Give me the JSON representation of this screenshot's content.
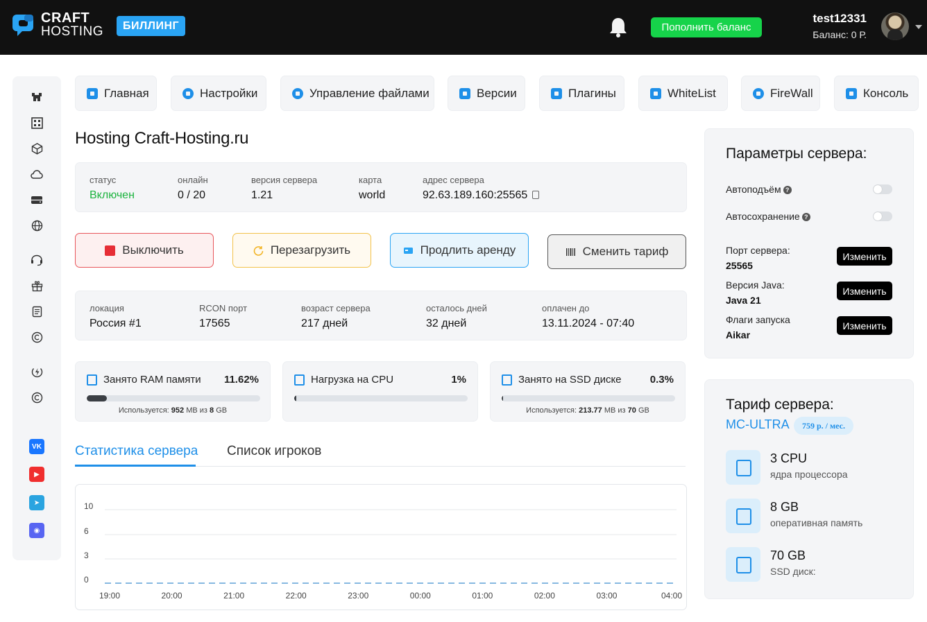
{
  "header": {
    "logo_line1": "CRAFT",
    "logo_line2": "HOSTING",
    "billing_badge": "БИЛЛИНГ",
    "topup_button": "Пополнить баланс",
    "username": "test12331",
    "balance": "Баланс: 0 Р."
  },
  "nav": {
    "tabs": [
      {
        "label": "Главная",
        "icon": "home-icon"
      },
      {
        "label": "Настройки",
        "icon": "gear-icon"
      },
      {
        "label": "Управление файлами",
        "icon": "cloud-icon"
      },
      {
        "label": "Версии",
        "icon": "versions-icon"
      },
      {
        "label": "Плагины",
        "icon": "plugins-icon"
      },
      {
        "label": "WhiteList",
        "icon": "list-icon"
      },
      {
        "label": "FireWall",
        "icon": "shield-icon"
      },
      {
        "label": "Консоль",
        "icon": "console-icon"
      }
    ]
  },
  "server": {
    "title": "Hosting Craft-Hosting.ru",
    "status_label": "статус",
    "status_value": "Включен",
    "online_label": "онлайн",
    "online_value": "0 / 20",
    "version_label": "версия сервера",
    "version_value": "1.21",
    "map_label": "карта",
    "map_value": "world",
    "address_label": "адрес сервера",
    "address_value": "92.63.189.160:25565"
  },
  "actions": {
    "stop": "Выключить",
    "restart": "Перезагрузить",
    "extend": "Продлить аренду",
    "change_tariff": "Сменить тариф"
  },
  "details": {
    "location_label": "локация",
    "location_value": "Россия #1",
    "rcon_label": "RCON порт",
    "rcon_value": "17565",
    "age_label": "возраст сервера",
    "age_value": "217 дней",
    "days_left_label": "осталось дней",
    "days_left_value": "32 дней",
    "paid_until_label": "оплачен до",
    "paid_until_value": "13.11.2024 - 07:40"
  },
  "resources": {
    "ram": {
      "title": "Занято RAM памяти",
      "percent": "11.62%",
      "fill": 0.1162,
      "note_prefix": "Используется:",
      "used": "952",
      "used_unit": "MB из",
      "total": "8",
      "total_unit": "GB"
    },
    "cpu": {
      "title": "Нагрузка на CPU",
      "percent": "1%",
      "fill": 0.01
    },
    "ssd": {
      "title": "Занято на SSD диске",
      "percent": "0.3%",
      "fill": 0.003,
      "note_prefix": "Используется:",
      "used": "213.77",
      "used_unit": "MB из",
      "total": "70",
      "total_unit": "GB"
    }
  },
  "subtabs": {
    "stats": "Статистика сервера",
    "players": "Список игроков"
  },
  "chart_data": {
    "type": "line",
    "x": [
      "19:00",
      "20:00",
      "21:00",
      "22:00",
      "23:00",
      "00:00",
      "01:00",
      "02:00",
      "03:00",
      "04:00"
    ],
    "y_ticks": [
      "10",
      "6",
      "3",
      "0"
    ],
    "ylim": [
      0,
      10
    ],
    "series": [
      {
        "values": [
          0,
          0,
          0,
          0,
          0,
          0,
          0,
          0,
          0,
          0
        ],
        "color": "#86b8e0"
      }
    ],
    "grid": true
  },
  "params": {
    "title": "Параметры сервера:",
    "autostart": "Автоподъём",
    "autosave": "Автосохранение",
    "help_glyph": "?",
    "port_label": "Порт сервера:",
    "port_value": "25565",
    "java_label": "Версия Java:",
    "java_value": "Java 21",
    "flags_label": "Флаги запуска",
    "flags_value": "Aikar",
    "change_label": "Изменить"
  },
  "tariff": {
    "title": "Тариф сервера:",
    "name": "MC-ULTRA",
    "price": "759 р. / мес.",
    "cpu_main": "3 CPU",
    "cpu_sub": "ядра процессора",
    "ram_main": "8 GB",
    "ram_sub": "оперативная память",
    "ssd_main": "70 GB",
    "ssd_sub": "SSD диск:"
  },
  "sidebar_icons": [
    "home-icon",
    "qr-icon",
    "cube-icon",
    "cloud-icon",
    "storage-icon",
    "globe-icon",
    "support-icon",
    "gift-icon",
    "document-icon",
    "copyright-icon",
    "energy-icon",
    "copyright-icon"
  ],
  "social": [
    {
      "name": "vk-icon",
      "glyph": "VK",
      "color": "#1976ff"
    },
    {
      "name": "youtube-icon",
      "glyph": "▶",
      "color": "#f02e2e"
    },
    {
      "name": "telegram-icon",
      "glyph": "➤",
      "color": "#2aa4e0"
    },
    {
      "name": "discord-icon",
      "glyph": "◉",
      "color": "#5865f2"
    }
  ],
  "colors": {
    "accent": "#1e8fe8",
    "success": "#16d34a",
    "danger": "#e83a3a"
  }
}
